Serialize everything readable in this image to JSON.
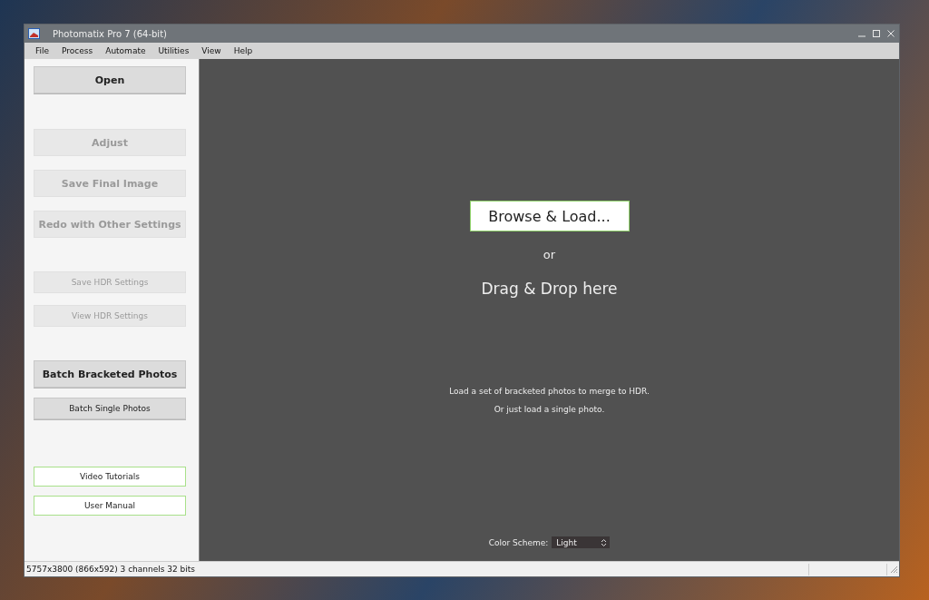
{
  "window": {
    "title": "Photomatix Pro 7  (64-bit)"
  },
  "menu": [
    "File",
    "Process",
    "Automate",
    "Utilities",
    "View",
    "Help"
  ],
  "sidebar": {
    "groups": [
      [
        {
          "label": "Open",
          "kind": "large",
          "disabled": false
        }
      ],
      [
        {
          "label": "Adjust",
          "kind": "large",
          "disabled": true
        },
        {
          "label": "Save Final Image",
          "kind": "large",
          "disabled": true
        },
        {
          "label": "Redo with Other Settings",
          "kind": "large",
          "disabled": true
        }
      ],
      [
        {
          "label": "Save HDR Settings",
          "kind": "small",
          "disabled": true
        },
        {
          "label": "View HDR Settings",
          "kind": "small",
          "disabled": true
        }
      ],
      [
        {
          "label": "Batch Bracketed Photos",
          "kind": "large",
          "disabled": false
        },
        {
          "label": "Batch Single Photos",
          "kind": "small",
          "disabled": false
        }
      ],
      [
        {
          "label": "Video Tutorials",
          "kind": "link",
          "disabled": false
        },
        {
          "label": "User Manual",
          "kind": "link",
          "disabled": false
        }
      ]
    ]
  },
  "main": {
    "browse_button": "Browse & Load...",
    "or": "or",
    "drop_hint": "Drag & Drop here",
    "notes": [
      "Load a set of bracketed photos to merge to HDR.",
      "Or just load a single photo."
    ],
    "color_scheme": {
      "label": "Color Scheme:",
      "value": "Light"
    }
  },
  "status_bar": "5757x3800 (866x592) 3 channels 32 bits"
}
